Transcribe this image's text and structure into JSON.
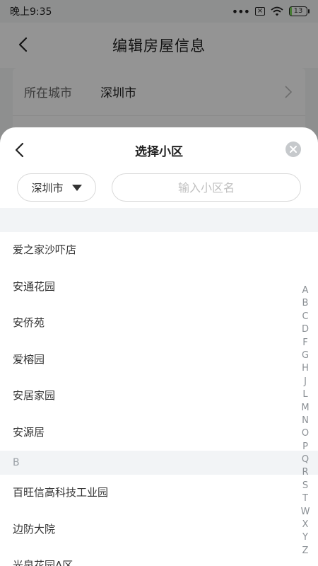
{
  "status_bar": {
    "time": "晚上9:35",
    "battery": "13",
    "battery_level_percent": 13,
    "icons": [
      "more-dots-icon",
      "sim-x-icon",
      "wifi-icon",
      "battery-icon"
    ]
  },
  "background_page": {
    "title": "编辑房屋信息",
    "rows": [
      {
        "label": "所在城市",
        "value": "深圳市"
      }
    ]
  },
  "sheet": {
    "title": "选择小区",
    "city_select": "深圳市",
    "search_placeholder": "输入小区名",
    "sections": [
      {
        "header": "",
        "items": [
          "爱之家沙吓店",
          "安通花园",
          "安侨苑",
          "爱榕园",
          "安居家园",
          "安源居"
        ]
      },
      {
        "header": "B",
        "items": [
          "百旺信高科技工业园",
          "边防大院",
          "光泉花园A区"
        ]
      }
    ],
    "index_letters": [
      "A",
      "B",
      "C",
      "D",
      "F",
      "G",
      "H",
      "J",
      "L",
      "M",
      "N",
      "O",
      "P",
      "Q",
      "R",
      "S",
      "T",
      "W",
      "X",
      "Y",
      "Z"
    ]
  },
  "colors": {
    "overlay": "rgba(0,0,0,0.42)",
    "section_bg": "#f2f4f6",
    "battery_fill": "#7bd65a"
  }
}
